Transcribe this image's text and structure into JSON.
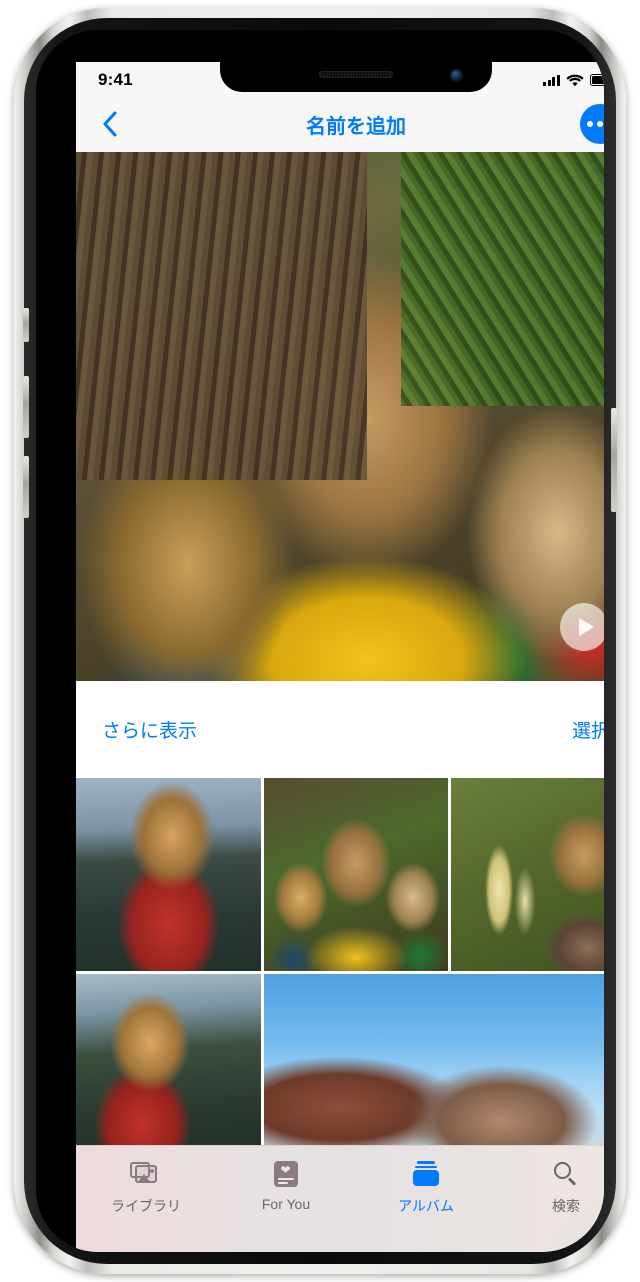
{
  "status_bar": {
    "time": "9:41",
    "signal_icon": "cellular-bars-icon",
    "wifi_icon": "wifi-icon",
    "battery_icon": "battery-full-icon"
  },
  "nav_bar": {
    "back_icon": "chevron-left-icon",
    "title": "名前を追加",
    "more_icon": "ellipsis-icon",
    "accent_color": "#007aff"
  },
  "hero": {
    "media_type": "video",
    "play_icon": "play-icon",
    "alt": "三人の子どもが木の前で寄り添っている写真"
  },
  "actions": {
    "show_more_label": "さらに表示",
    "select_label": "選択"
  },
  "grid": {
    "rows": [
      {
        "cells": [
          {
            "name": "photo-lake-red-hoodie",
            "span": 1,
            "style": "ph-lake"
          },
          {
            "name": "photo-three-siblings",
            "span": 1,
            "style": "ph-family"
          },
          {
            "name": "photo-beargrass-flowers",
            "span": 1,
            "style": "ph-flowers"
          }
        ]
      },
      {
        "cells": [
          {
            "name": "photo-lake-forest",
            "span": 1,
            "style": "ph-lake2"
          },
          {
            "name": "photo-sky-selfie",
            "span": 2,
            "style": "ph-selfie"
          }
        ]
      }
    ]
  },
  "tab_bar": {
    "items": [
      {
        "label": "ライブラリ",
        "icon": "photo-library-icon",
        "active": false
      },
      {
        "label": "For You",
        "icon": "for-you-heart-icon",
        "active": false
      },
      {
        "label": "アルバム",
        "icon": "albums-icon",
        "active": true
      },
      {
        "label": "検索",
        "icon": "magnifier-icon",
        "active": false
      }
    ],
    "active_color": "#007aff",
    "inactive_color": "#6f6368"
  },
  "home_indicator": "home-indicator"
}
